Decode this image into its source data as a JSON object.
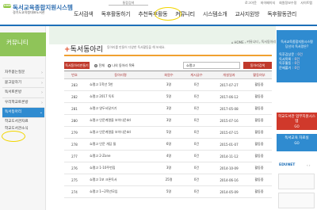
{
  "header": {
    "logo_badge": "2008",
    "logo_title": "독서교육종합지원시스템",
    "logo_subtitle": "경기도교육청대표도서관",
    "top_search_label": "통합검색",
    "util_links": [
      "로그아웃",
      "마이페이지",
      "회원정보수정",
      "사이트맵"
    ],
    "nav": [
      "도서검색",
      "독후활동하기",
      "추천독후활동",
      "커뮤니티",
      "시스템소개",
      "교사지원방",
      "독후활동관리"
    ],
    "active_nav": "커뮤니티",
    "colors": {
      "brand_blue": "#1d6fb8",
      "green": "#8fc459",
      "highlight_circle": "#f2d500"
    }
  },
  "sidebar": {
    "title": "커뮤니티",
    "items": [
      "자주묻는질문",
      "묻고답하기",
      "독서토론방",
      "우리학교토론방",
      "독서동아리"
    ],
    "active_item": "독서동아리",
    "extra_items": [
      "학교도서관자료",
      "학교도서관소식"
    ]
  },
  "main": {
    "breadcrumb": [
      "HOME",
      "커뮤니티",
      "독서동아리"
    ],
    "title": "독서동아리",
    "description": "동아리를 만들어 다양한 독서활동을 해 보세요.",
    "create_button": "독서동아리만들기",
    "filters": [
      "전체",
      "나의 동아리 목록"
    ],
    "selected_filter": "전체",
    "search_value": "쇼팽고",
    "search_button": "동아리검색",
    "table": {
      "headers": [
        "번호",
        "동아리명",
        "회원수",
        "게시글수",
        "개설일자",
        "활동여부"
      ],
      "rows": [
        [
          "283",
          "쇼팽고 1학년 5반",
          "3명",
          "0건",
          "2017-07-27",
          "활동중"
        ],
        [
          "282",
          "쇼팽고 2017 독토",
          "5명",
          "0건",
          "2017-06-12",
          "활동중"
        ],
        [
          "281",
          "쇼팽고 영두서달거기",
          "3명",
          "0건",
          "2017-05-08",
          "활동중"
        ],
        [
          "280",
          "쇼팽고 인문계열을 보이다운dd",
          "3명",
          "0건",
          "2015-07-16",
          "활동중"
        ],
        [
          "279",
          "쇼팽고 인문계열을 보이다운dd",
          "5명",
          "0건",
          "2015-07-15",
          "활동중"
        ],
        [
          "278",
          "쇼팽고 인문 개담 될",
          "6명",
          "0건",
          "2015-01-07",
          "활동중"
        ],
        [
          "277",
          "쇼팽고 2-Zone",
          "4명",
          "0건",
          "2014-11-12",
          "활동중"
        ],
        [
          "276",
          "쇼팽고 1-10주번집",
          "3명",
          "0건",
          "2014-10-09",
          "활동중"
        ],
        [
          "275",
          "쇼팽고 1보 크론독서",
          "25명",
          "0건",
          "2014-06-16",
          "활동중"
        ],
        [
          "274",
          "쇼팽고 1~2학년모임",
          "5명",
          "0건",
          "2014-05-09",
          "활동중"
        ]
      ]
    }
  },
  "right_sidebar": {
    "panel_title": "독서교육종합지원시스템 당신의 독서량은?",
    "stats": [
      {
        "label": "독후감상문",
        "value": "0건"
      },
      {
        "label": "독서목록",
        "value": "0건"
      },
      {
        "label": "독후활동",
        "value": "0건"
      },
      {
        "label": "문제풀기",
        "value": "0건"
      }
    ],
    "buttons": [
      {
        "label": "학교도서관 업무지원시스템",
        "go": "GO",
        "color": "#d0392b"
      },
      {
        "label": "독서교육 자료실",
        "go": "GO",
        "color": "#2f8bd0"
      }
    ],
    "partner_logo": "EDUNET"
  }
}
